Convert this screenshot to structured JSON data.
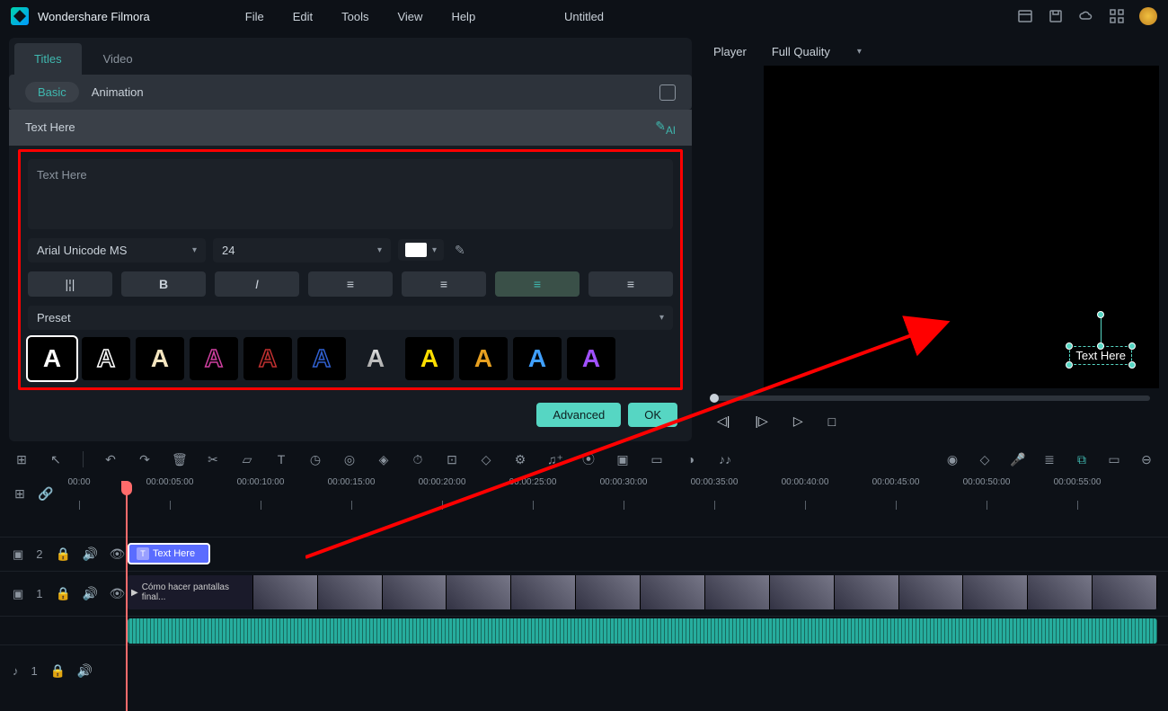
{
  "app": {
    "name": "Wondershare Filmora",
    "document": "Untitled"
  },
  "menu": {
    "file": "File",
    "edit": "Edit",
    "tools": "Tools",
    "view": "View",
    "help": "Help"
  },
  "left": {
    "tabs": {
      "titles": "Titles",
      "video": "Video"
    },
    "subtabs": {
      "basic": "Basic",
      "animation": "Animation"
    },
    "text_label": "Text Here",
    "textarea_value": "Text Here",
    "font": "Arial Unicode MS",
    "font_size": "24",
    "preset_label": "Preset",
    "ai_label": "AI",
    "buttons": {
      "advanced": "Advanced",
      "ok": "OK"
    }
  },
  "player": {
    "label": "Player",
    "quality": "Full Quality",
    "overlay_text": "Text Here"
  },
  "timeline": {
    "times": [
      "00:00",
      "00:00:05:00",
      "00:00:10:00",
      "00:00:15:00",
      "00:00:20:00",
      "00:00:25:00",
      "00:00:30:00",
      "00:00:35:00",
      "00:00:40:00",
      "00:00:45:00",
      "00:00:50:00",
      "00:00:55:00"
    ],
    "text_track_label": "2",
    "video_track_label": "1",
    "audio_track_label": "1",
    "text_clip_label": "Text Here",
    "video_clip_label": "Cómo hacer pantallas final..."
  }
}
